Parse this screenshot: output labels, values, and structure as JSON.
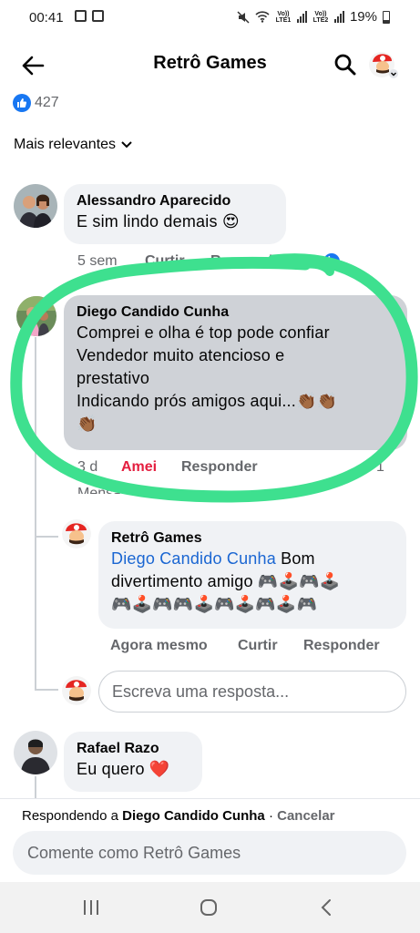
{
  "status": {
    "time": "00:41",
    "battery_text": "19%",
    "lte1": "Vo)) LTE1",
    "lte2": "Vo)) LTE2"
  },
  "header": {
    "title": "Retrô Games",
    "back_icon": "arrow-left-icon",
    "search_icon": "search-icon"
  },
  "reactions": {
    "count": "427",
    "icon": "like-icon"
  },
  "sort": {
    "label": "Mais relevantes",
    "icon": "chevron-down-icon"
  },
  "comments": [
    {
      "author": "Alessandro Aparecido",
      "text": "E sim lindo demais 😍",
      "time": "5 sem",
      "like_label": "Curtir",
      "reply_label": "Responder",
      "reaction_count": "2"
    },
    {
      "author": "Diego Candido Cunha",
      "lines": [
        "Comprei e olha é top pode confiar",
        "Vendedor muito atencioso e",
        "prestativo",
        "Indicando prós amigos aqui...👏🏾👏🏾",
        "👏🏾"
      ],
      "time": "3 d",
      "reaction_label": "Amei",
      "reply_label": "Responder",
      "reaction_count": "1",
      "partial_label": "Mensagem"
    },
    {
      "author": "Rafael Razo",
      "text": "Eu quero ❤️"
    }
  ],
  "reply": {
    "author": "Retrô Games",
    "mention": "Diego Candido Cunha",
    "text_line1": "Bom",
    "text_line2": "divertimento amigo 🎮🕹️🎮🕹️",
    "text_line3": "🎮🕹️🎮🎮🕹️🎮🕹️🎮🕹️🎮",
    "time": "Agora mesmo",
    "like_label": "Curtir",
    "reply_label": "Responder"
  },
  "reply_input": {
    "placeholder": "Escreva uma resposta..."
  },
  "replying_bar": {
    "prefix": "Respondendo a",
    "name": "Diego Candido Cunha",
    "separator": " · ",
    "cancel": "Cancelar"
  },
  "comment_box": {
    "placeholder": "Comente como Retrô Games"
  },
  "highlight_color": "#3ee08f",
  "accent_color": "#1877f2",
  "love_color": "#e41e3f",
  "nav": {
    "recents_icon": "recents-icon",
    "home_icon": "home-icon",
    "back_icon": "back-icon"
  }
}
